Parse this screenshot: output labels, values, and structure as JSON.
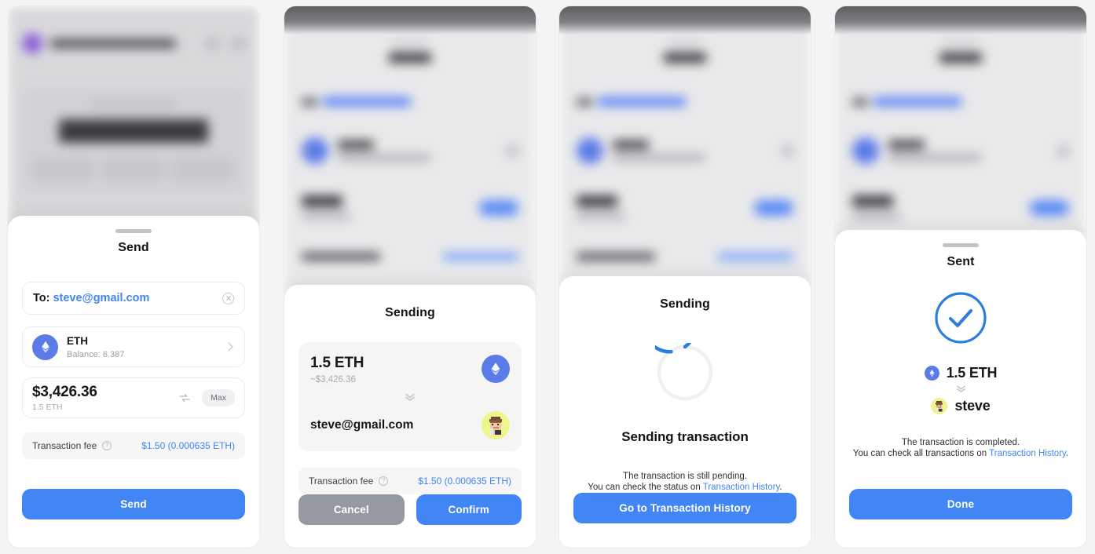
{
  "app": {
    "accent_blue": "#4285f4",
    "secondary_gray": "#9499a2",
    "eth_badge_color": "#5b7ce8",
    "avatar_bg": "#eef58c"
  },
  "shared": {
    "fee_label": "Transaction fee",
    "fee_value": "$1.50 (0.000635 ETH)",
    "info_icon": "question-mark-circle-icon",
    "grab_handle": "drag-handle"
  },
  "panel1": {
    "sheet_title": "Send",
    "to_label": "To:",
    "to_value": "steve@gmail.com",
    "clear_icon": "clear-circle-icon",
    "token": {
      "symbol": "ETH",
      "balance": "Balance: 6.387",
      "icon": "ethereum-icon",
      "chevron": "chevron-right-icon"
    },
    "amount": {
      "fiat": "$3,426.36",
      "crypto": "1.5 ETH",
      "swap_icon": "swap-currency-icon",
      "max_label": "Max"
    },
    "fee_label": "Transaction fee",
    "fee_value": "$1.50 (0.000635 ETH)",
    "primary_button": "Send"
  },
  "panel2": {
    "sheet_title": "Sending",
    "summary": {
      "amount": "1.5 ETH",
      "fiat": "~$3,426.36",
      "coin_icon": "ethereum-icon",
      "direction_icon": "double-chevron-down-icon",
      "recipient": "steve@gmail.com",
      "recipient_avatar": "user-avatar"
    },
    "fee_label": "Transaction fee",
    "fee_value": "$1.50 (0.000635 ETH)",
    "cancel_button": "Cancel",
    "confirm_button": "Confirm"
  },
  "panel3": {
    "sheet_title": "Sending",
    "spinner_icon": "loading-spinner-icon",
    "status_heading": "Sending transaction",
    "note_line1": "The transaction is still pending.",
    "note_line2_prefix": "You can check the status on ",
    "note_link": "Transaction History",
    "note_suffix": ".",
    "primary_button": "Go to Transaction History"
  },
  "panel4": {
    "sheet_title": "Sent",
    "success_icon": "check-circle-icon",
    "amount": "1.5 ETH",
    "coin_icon": "ethereum-icon",
    "direction_icon": "double-chevron-down-icon",
    "recipient": "steve",
    "recipient_avatar": "user-avatar",
    "note_line1": "The transaction is completed.",
    "note_line2_prefix": "You can check all transactions on ",
    "note_link": "Transaction History",
    "note_suffix": ".",
    "primary_button": "Done"
  }
}
